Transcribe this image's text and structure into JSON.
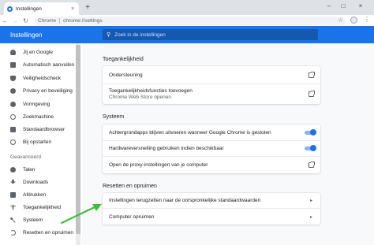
{
  "browser": {
    "tab_title": "Instellingen",
    "tab_close": "×",
    "new_tab": "+",
    "window_minimize": "–",
    "window_maximize": "□",
    "window_close": "×",
    "site_label": "Chrome",
    "url": "chrome://settings",
    "star": "☆",
    "menu": "⋮"
  },
  "header": {
    "title": "Instellingen",
    "search_placeholder": "Zoek in de instellingen"
  },
  "sidebar": {
    "items_top": [
      {
        "label": "Jij en Google",
        "icon": "person-icon"
      },
      {
        "label": "Automatisch aanvullen",
        "icon": "assignment-icon"
      },
      {
        "label": "Veiligheidscheck",
        "icon": "shield-icon"
      },
      {
        "label": "Privacy en beveiliging",
        "icon": "security-icon"
      },
      {
        "label": "Vormgeving",
        "icon": "palette-icon"
      },
      {
        "label": "Zoekmachine",
        "icon": "search-icon"
      },
      {
        "label": "Standaardbrowser",
        "icon": "browser-icon"
      },
      {
        "label": "Bij opstarten",
        "icon": "power-icon"
      }
    ],
    "advanced_label": "Geavanceerd",
    "items_advanced": [
      {
        "label": "Talen",
        "icon": "language-icon"
      },
      {
        "label": "Downloads",
        "icon": "download-icon"
      },
      {
        "label": "Afdrukken",
        "icon": "print-icon"
      },
      {
        "label": "Toegankelijkheid",
        "icon": "accessibility-icon"
      },
      {
        "label": "Systeem",
        "icon": "wrench-icon"
      },
      {
        "label": "Resetten en opruimen",
        "icon": "restore-icon"
      }
    ]
  },
  "main": {
    "accessibility": {
      "title": "Toegankelijkheid",
      "rows": [
        {
          "label": "Ondersteuning"
        },
        {
          "label": "Toegankelijkheidsfuncties toevoegen",
          "sublabel": "Chrome Web Store openen"
        }
      ]
    },
    "system": {
      "title": "Systeem",
      "rows": [
        {
          "label": "Achtergrondapps blijven uitvoeren wanneer Google Chrome is gesloten",
          "toggle_on": true
        },
        {
          "label": "Hardwareversnelling gebruiken indien beschikbaar",
          "toggle_on": true
        },
        {
          "label": "Open de proxy-instellingen van je computer"
        }
      ]
    },
    "reset": {
      "title": "Resetten en opruimen",
      "rows": [
        {
          "label": "Instellingen terugzetten naar de oorspronkelijke standaardwaarden"
        },
        {
          "label": "Computer opruimen"
        }
      ]
    }
  },
  "colors": {
    "accent": "#1a73e8",
    "annotation_arrow": "#3fbf3f"
  }
}
